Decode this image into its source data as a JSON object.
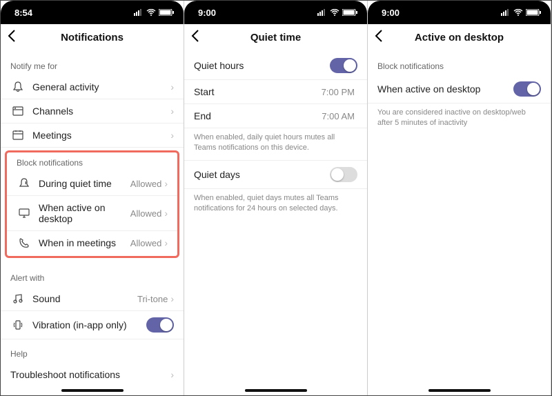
{
  "screen1": {
    "time": "8:54",
    "title": "Notifications",
    "notify_header": "Notify me for",
    "notify_items": {
      "general": "General activity",
      "channels": "Channels",
      "meetings": "Meetings"
    },
    "block_header": "Block notifications",
    "block_items": {
      "quiet": {
        "label": "During quiet time",
        "value": "Allowed"
      },
      "desktop": {
        "label": "When active on desktop",
        "value": "Allowed"
      },
      "inmeet": {
        "label": "When in meetings",
        "value": "Allowed"
      }
    },
    "alert_header": "Alert with",
    "alert_items": {
      "sound": {
        "label": "Sound",
        "value": "Tri-tone"
      },
      "vibration": {
        "label": "Vibration (in-app only)"
      }
    },
    "help_header": "Help",
    "help_item": "Troubleshoot notifications"
  },
  "screen2": {
    "time": "9:00",
    "title": "Quiet time",
    "hours": {
      "label": "Quiet hours"
    },
    "start": {
      "label": "Start",
      "value": "7:00 PM"
    },
    "end": {
      "label": "End",
      "value": "7:00 AM"
    },
    "hours_help": "When enabled, daily quiet hours mutes all Teams notifications on this device.",
    "days": {
      "label": "Quiet days"
    },
    "days_help": "When enabled, quiet days mutes all Teams notifications for 24 hours on selected days."
  },
  "screen3": {
    "time": "9:00",
    "title": "Active on desktop",
    "section_header": "Block notifications",
    "row": {
      "label": "When active on desktop"
    },
    "help": "You are considered inactive on desktop/web after 5 minutes of inactivity"
  }
}
